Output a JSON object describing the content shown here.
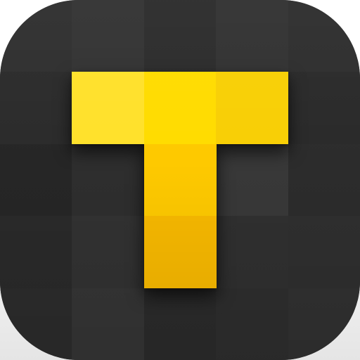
{
  "icon": {
    "name": "letter-t-icon",
    "background_color": "#2d2d2d",
    "grid_columns": 5,
    "grid_rows": 5,
    "tile_colors": [
      [
        "#2f2f2f",
        "#333333",
        "#2c2c2c",
        "#323232",
        "#2e2e2e"
      ],
      [
        "#2b2b2b",
        "#303030",
        "#2d2d2d",
        "#353535",
        "#2a2a2a"
      ],
      [
        "#262626",
        "#2e2e2e",
        "#2b2b2b",
        "#383838",
        "#2c2c2c"
      ],
      [
        "#2a2a2a",
        "#323232",
        "#2d2d2d",
        "#303030",
        "#2f2f2f"
      ],
      [
        "#2c2c2c",
        "#353535",
        "#2b2b2b",
        "#2e2e2e",
        "#313131"
      ]
    ],
    "glyph_tiles": [
      {
        "row": 1,
        "col": 1,
        "color": "#ffe12b"
      },
      {
        "row": 1,
        "col": 2,
        "color": "#ffdc00"
      },
      {
        "row": 1,
        "col": 3,
        "color": "#f8cf05"
      },
      {
        "row": 2,
        "col": 2,
        "color": "#fec900"
      },
      {
        "row": 3,
        "col": 2,
        "color": "#f8b900"
      }
    ]
  }
}
